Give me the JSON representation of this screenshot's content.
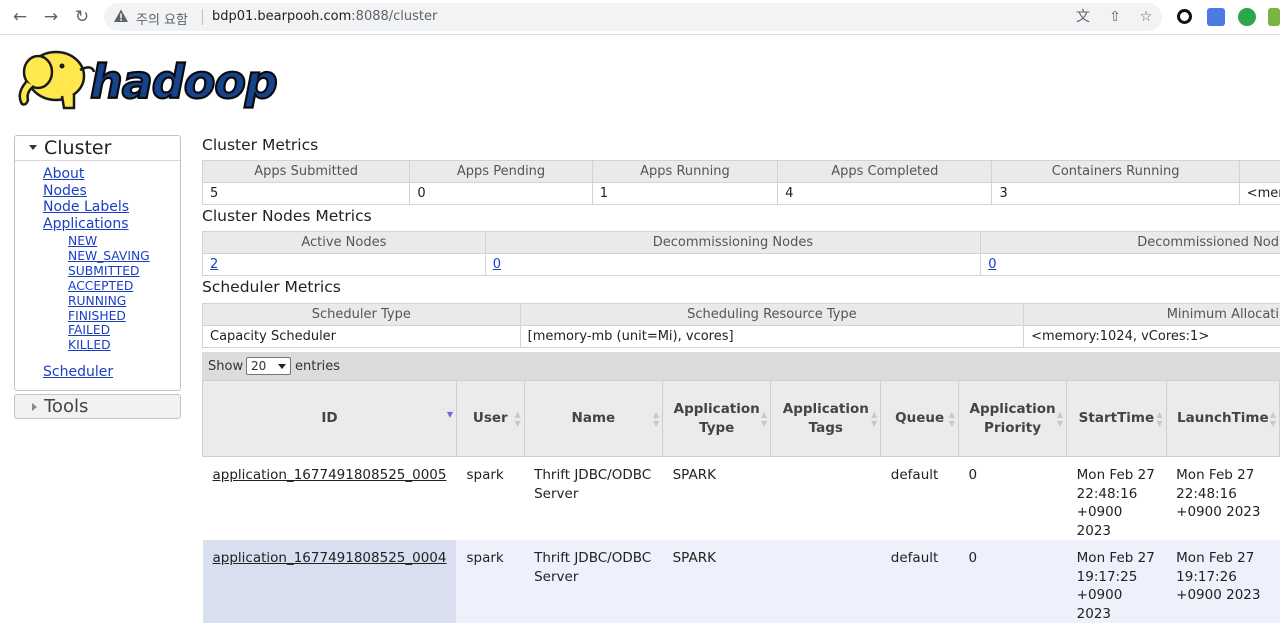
{
  "browser": {
    "warning_text": "주의 요함",
    "url_host": "bdp01.bearpooh.com",
    "url_path": ":8088/cluster"
  },
  "logo": {
    "text": "hadoop"
  },
  "nav": {
    "cluster_title": "Cluster",
    "links": [
      "About",
      "Nodes",
      "Node Labels",
      "Applications"
    ],
    "app_states": [
      "NEW",
      "NEW_SAVING",
      "SUBMITTED",
      "ACCEPTED",
      "RUNNING",
      "FINISHED",
      "FAILED",
      "KILLED"
    ],
    "scheduler": "Scheduler",
    "tools_title": "Tools"
  },
  "cluster_metrics": {
    "title": "Cluster Metrics",
    "headers": [
      "Apps Submitted",
      "Apps Pending",
      "Apps Running",
      "Apps Completed",
      "Containers Running"
    ],
    "values": [
      "5",
      "0",
      "1",
      "4",
      "3",
      "<mem"
    ]
  },
  "node_metrics": {
    "title": "Cluster Nodes Metrics",
    "headers": [
      "Active Nodes",
      "Decommissioning Nodes",
      "Decommissioned Nod"
    ],
    "values": [
      "2",
      "0",
      "0"
    ]
  },
  "scheduler_metrics": {
    "title": "Scheduler Metrics",
    "headers": [
      "Scheduler Type",
      "Scheduling Resource Type",
      "Minimum Allocati"
    ],
    "values": [
      "Capacity Scheduler",
      "[memory-mb (unit=Mi), vcores]",
      "<memory:1024, vCores:1>"
    ]
  },
  "apps_table": {
    "show_label": "Show",
    "page_size": "20",
    "entries_label": "entries",
    "headers": {
      "id": "ID",
      "user": "User",
      "name": "Name",
      "app_type": "Application Type",
      "app_tags": "Application Tags",
      "queue": "Queue",
      "priority": "Application Priority",
      "start": "StartTime",
      "launch": "LaunchTime"
    },
    "rows": [
      {
        "id": "application_1677491808525_0005",
        "user": "spark",
        "name": "Thrift JDBC/ODBC Server",
        "app_type": "SPARK",
        "app_tags": "",
        "queue": "default",
        "priority": "0",
        "start": "Mon Feb 27 22:48:16 +0900 2023",
        "launch": "Mon Feb 27 22:48:16 +0900 2023"
      },
      {
        "id": "application_1677491808525_0004",
        "user": "spark",
        "name": "Thrift JDBC/ODBC Server",
        "app_type": "SPARK",
        "app_tags": "",
        "queue": "default",
        "priority": "0",
        "start": "Mon Feb 27 19:17:25 +0900 2023",
        "launch": "Mon Feb 27 19:17:26 +0900 2023"
      }
    ]
  }
}
